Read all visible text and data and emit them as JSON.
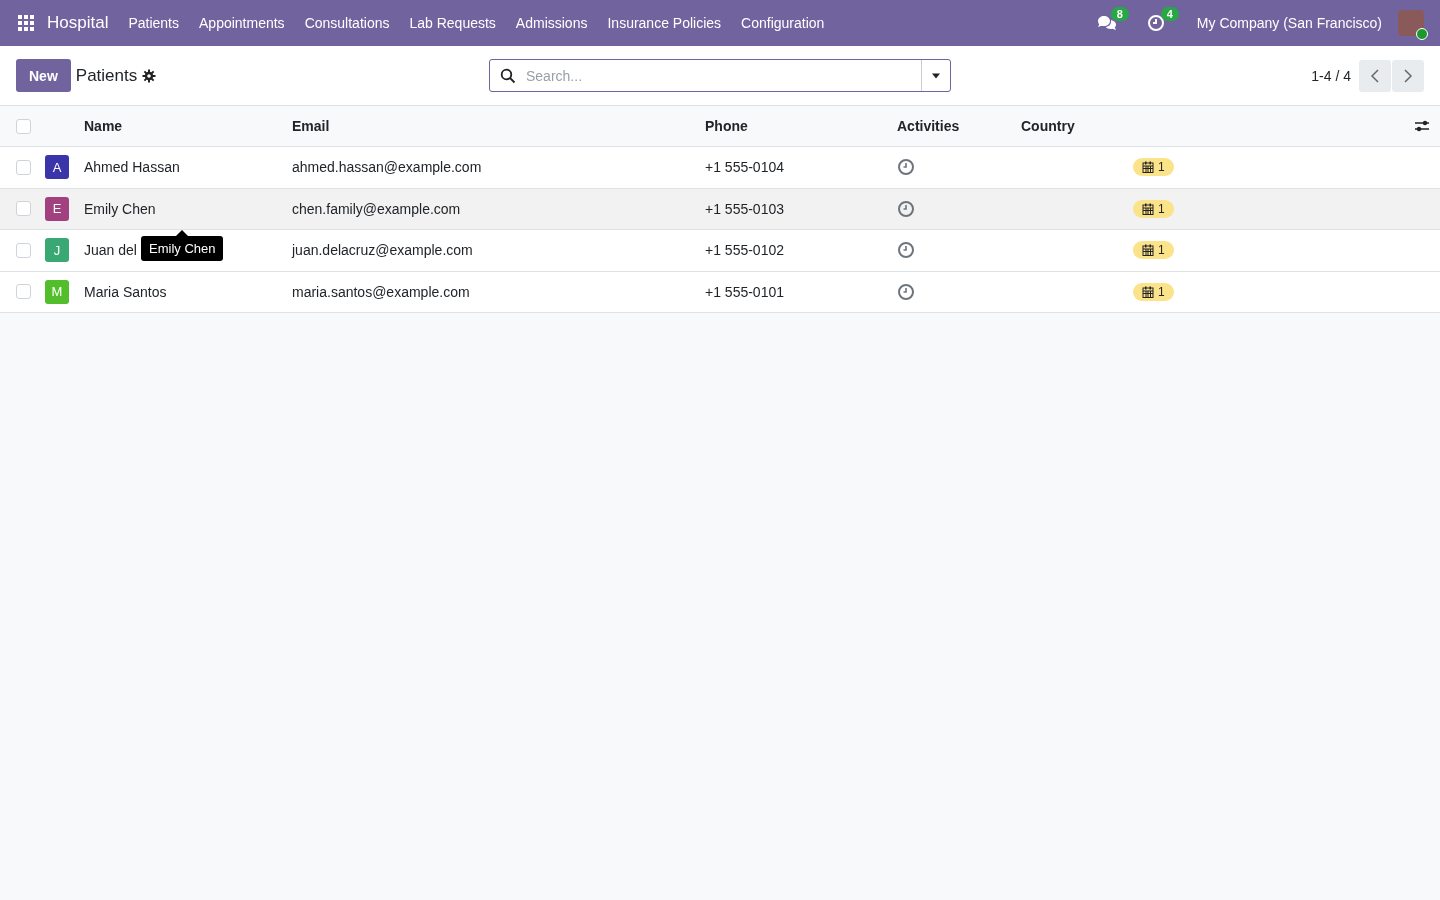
{
  "navbar": {
    "app": "Hospital",
    "menus": [
      "Patients",
      "Appointments",
      "Consultations",
      "Lab Requests",
      "Admissions",
      "Insurance Policies",
      "Configuration"
    ],
    "messages_count": "8",
    "activities_count": "4",
    "company": "My Company (San Francisco)"
  },
  "control_panel": {
    "new_button": "New",
    "title": "Patients",
    "search": {
      "placeholder": "Search..."
    },
    "pager": "1-4 / 4"
  },
  "table": {
    "all_checked": false,
    "columns": [
      "Name",
      "Email",
      "Phone",
      "Activities",
      "Country"
    ],
    "rows": [
      {
        "initial": "A",
        "color": "#3a35a8",
        "name": "Ahmed Hassan",
        "email": "ahmed.hassan@example.com",
        "phone": "+1 555-0104",
        "column_6": "1",
        "checked": false,
        "hovered": false
      },
      {
        "initial": "E",
        "color": "#a2417f",
        "name": "Emily Chen",
        "email": "chen.family@example.com",
        "phone": "+1 555-0103",
        "column_6": "1",
        "checked": false,
        "hovered": true
      },
      {
        "initial": "J",
        "color": "#3aa873",
        "name": "Juan del",
        "email": "juan.delacruz@example.com",
        "phone": "+1 555-0102",
        "column_6": "1",
        "checked": false,
        "hovered": false
      },
      {
        "initial": "M",
        "color": "#52be2b",
        "name": "Maria Santos",
        "email": "maria.santos@example.com",
        "phone": "+1 555-0101",
        "column_6": "1",
        "checked": false,
        "hovered": false
      }
    ]
  },
  "tooltip": {
    "text": "Emily Chen"
  }
}
